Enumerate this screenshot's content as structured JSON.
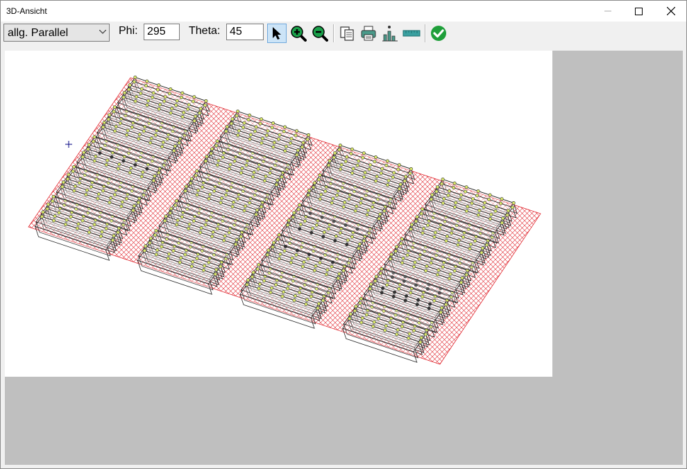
{
  "window": {
    "title": "3D-Ansicht"
  },
  "toolbar": {
    "projection": {
      "selected": "allg. Parallel"
    },
    "phi": {
      "label": "Phi:",
      "value": "295"
    },
    "theta": {
      "label": "Theta:",
      "value": "45"
    },
    "tools": [
      "cursor-icon",
      "zoom-in-icon",
      "zoom-out-icon",
      "copy-icon",
      "print-icon",
      "chart-icon",
      "ruler-icon",
      "ok-check-icon"
    ]
  },
  "colors": {
    "hatch": "#e0242c",
    "accent_ok": "#1f9f3a",
    "workspace": "#bfbfbf"
  }
}
